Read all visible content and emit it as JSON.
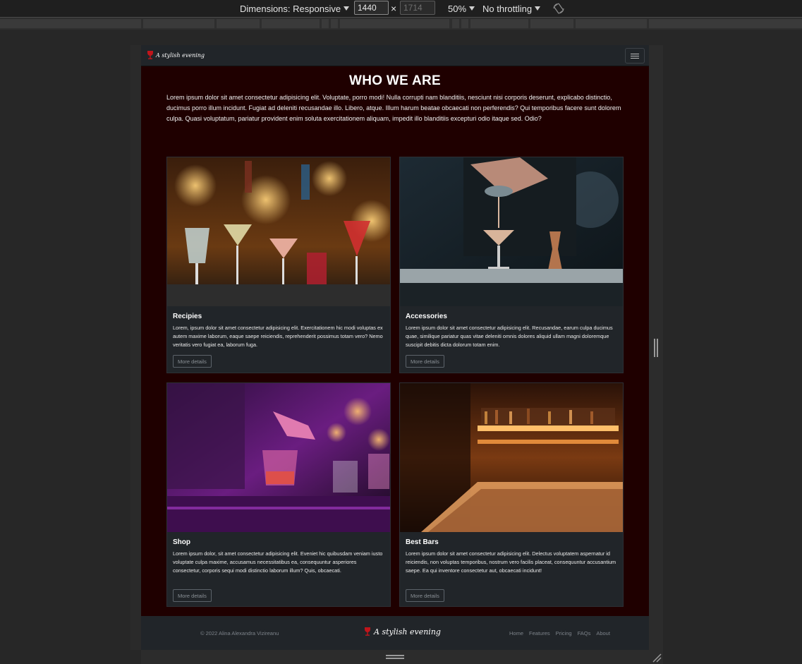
{
  "devtools": {
    "dimensions_label": "Dimensions: Responsive",
    "width_value": "1440",
    "times_symbol": "×",
    "height_placeholder": "1714",
    "zoom_label": "50%",
    "throttling_label": "No throttling",
    "rotate_icon": "rotate-icon"
  },
  "site": {
    "brand": "A stylish evening",
    "brand_icon": "wine-glass-icon",
    "menu_icon": "hamburger-icon",
    "accent_color": "#1f0000",
    "who": {
      "title": "WHO WE ARE",
      "text": "Lorem ipsum dolor sit amet consectetur adipisicing elit. Voluptate, porro modi! Nulla corrupti nam blanditiis, nesciunt nisi corporis deserunt, explicabo distinctio, ducimus porro illum incidunt. Fugiat ad deleniti recusandae illo. Libero, atque. Illum harum beatae obcaecati non perferendis? Qui temporibus facere sunt dolorem culpa. Quasi voluptatum, pariatur provident enim soluta exercitationem aliquam, impedit illo blanditiis excepturi odio itaque sed. Odio?"
    },
    "cards": [
      {
        "title": "Recipies",
        "text": "Lorem, ipsum dolor sit amet consectetur adipisicing elit. Exercitationem hic modi voluptas ex autem maxime laborum, eaque saepe reiciendis, reprehenderit possimus totam vero? Nemo veritatis vero fugiat ea, laborum fuga.",
        "button": "More details",
        "image": "cocktail-glasses-on-bar-photo"
      },
      {
        "title": "Accessories",
        "text": "Lorem ipsum dolor sit amet consectetur adipisicing elit. Recusandae, earum culpa ducimus quae, similique pariatur quas vitae deleniti omnis dolores aliquid ullam magni doloremque suscipit debitis dicta dolorum totam enim.",
        "button": "More details",
        "image": "bartender-straining-cocktail-photo"
      },
      {
        "title": "Shop",
        "text": "Lorem ipsum dolor, sit amet consectetur adipisicing elit. Eveniet hic quibusdam veniam iusto voluptate culpa maxime, accusamus necessitatibus ea, consequuntur asperiores consectetur, corporis sequi modi distinctio laborum illum? Quis, obcaecati.",
        "button": "More details",
        "image": "pouring-drink-purple-light-photo"
      },
      {
        "title": "Best Bars",
        "text": "Lorem ipsum dolor sit amet consectetur adipisicing elit. Delectus voluptatem aspernatur id reiciendis, non voluptas temporibus, nostrum vero facilis placeat, consequuntur accusantium saepe. Ea qui inventore consectetur aut, obcaecati incidunt!",
        "button": "More details",
        "image": "warm-lit-bar-interior-photo"
      }
    ],
    "footer": {
      "copyright": "© 2022 Alina Alexandra Vizireanu",
      "brand": "A stylish evening",
      "links": [
        "Home",
        "Features",
        "Pricing",
        "FAQs",
        "About"
      ]
    }
  }
}
